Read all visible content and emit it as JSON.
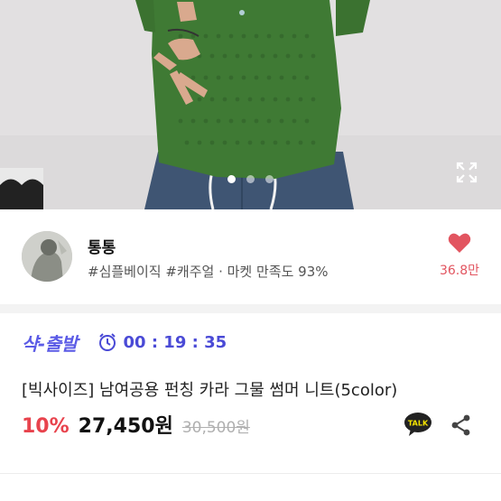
{
  "gallery": {
    "dots": [
      true,
      false,
      false
    ],
    "expand_icon": "expand-icon"
  },
  "seller": {
    "name": "통통",
    "tags": "#심플베이직 #캐주얼 · 마켓 만족도 93%",
    "like_count": "36.8만",
    "like_color": "#e25560"
  },
  "promo": {
    "logo": "샥-출발",
    "timer": "00 : 19 : 35",
    "accent": "#5b5be6"
  },
  "product": {
    "title": "[빅사이즈] 남여공용 펀칭 카라 그물 썸머 니트(5color)",
    "discount": "10%",
    "price": "27,450원",
    "original_price": "30,500원",
    "talk_label": "TALK",
    "discount_color": "#e8434d"
  }
}
